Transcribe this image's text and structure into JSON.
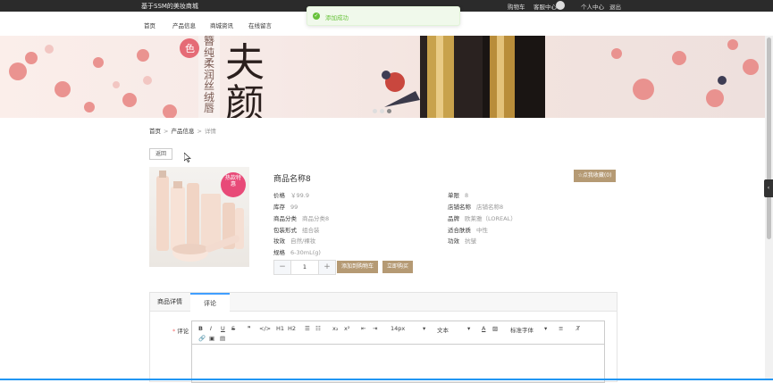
{
  "header": {
    "site_title": "基于SSM的美妆商城",
    "links": {
      "cart": "购物车",
      "service": "客服中心",
      "profile": "个人中心",
      "logout": "退出"
    }
  },
  "toast": {
    "message": "添加成功",
    "icon": "check-circle-icon",
    "color": "#67c23a"
  },
  "nav": {
    "items": [
      "首页",
      "产品信息",
      "商城资讯",
      "在线留言"
    ]
  },
  "banner": {
    "text_large": "夫颜",
    "text_vertical": "簪纯柔润丝绒唇",
    "badge_char": "色",
    "active_slide": 3,
    "slides": 3
  },
  "breadcrumb": {
    "home": "首页",
    "section": "产品信息",
    "current": "详情",
    "separator": ">"
  },
  "back_button": "返回",
  "product": {
    "name": "商品名称8",
    "image_badge": "热款特惠",
    "favorite_button": "☆点我收藏(0)",
    "attributes": [
      {
        "label": "价格",
        "value": "￥99.9"
      },
      {
        "label": "单限",
        "value": "8"
      },
      {
        "label": "库存",
        "value": "99"
      },
      {
        "label": "店铺名称",
        "value": "店铺名称8"
      },
      {
        "label": "商品分类",
        "value": "商品分类8"
      },
      {
        "label": "品牌",
        "value": "欧莱雅（LOREAL）"
      },
      {
        "label": "包装形式",
        "value": "组合装"
      },
      {
        "label": "适合肤质",
        "value": "中性"
      },
      {
        "label": "妆效",
        "value": "自然/裸妆"
      },
      {
        "label": "功效",
        "value": "抗皱"
      },
      {
        "label": "规格",
        "value": "6-30mL(g)"
      }
    ],
    "quantity": "1",
    "minus": "−",
    "plus": "+",
    "add_to_cart": "添加到购物车",
    "buy_now": "立即购买"
  },
  "tabs": {
    "items": [
      "商品详情",
      "评论"
    ],
    "active": "评论"
  },
  "comment": {
    "label": "评论",
    "required_mark": "*",
    "toolbar": {
      "bold": "B",
      "italic": "I",
      "underline": "U",
      "strike": "S",
      "quote": "❞",
      "code": "</>",
      "h1": "H1",
      "h2": "H2",
      "ol": "☰",
      "ul": "☷",
      "sub": "x₂",
      "sup": "x²",
      "outdent": "⇤",
      "indent": "⇥",
      "size": "14px",
      "header": "文本",
      "font_color": "A",
      "bg_color": "▨",
      "font": "标准字体",
      "align": "≡",
      "clean": "T̸",
      "link": "🔗",
      "image": "▣",
      "video": "▤"
    }
  },
  "colors": {
    "accent": "#b59a74",
    "topbar": "#2b2b2b",
    "tab_active": "#409eff"
  }
}
